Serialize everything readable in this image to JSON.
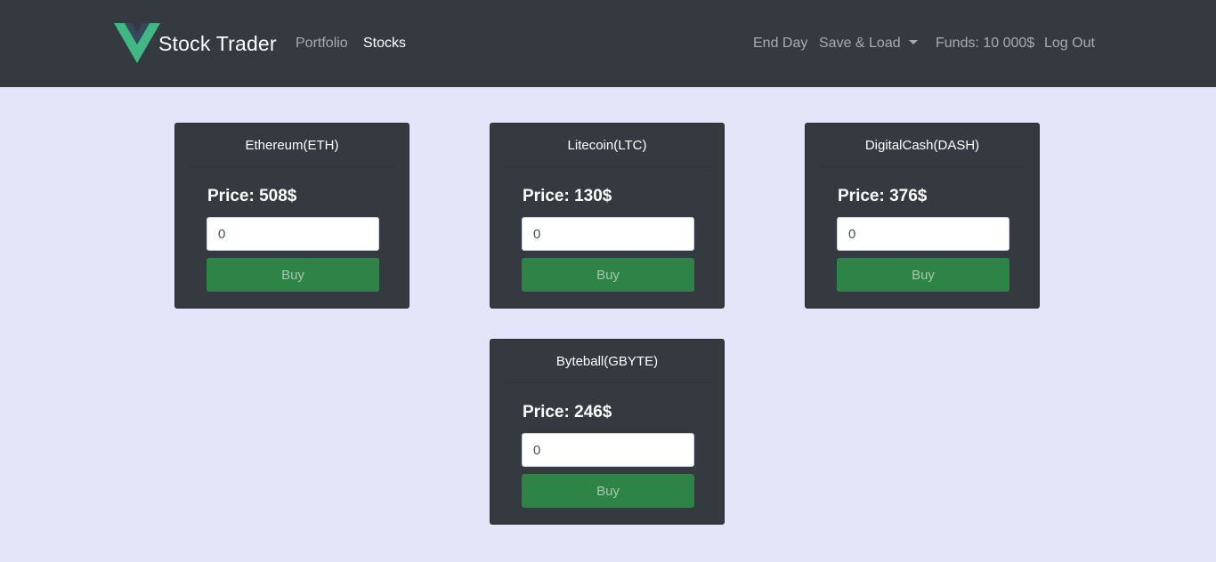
{
  "brand": {
    "name": "Stock Trader",
    "logo_icon": "vue-logo-icon"
  },
  "nav": {
    "portfolio": "Portfolio",
    "stocks": "Stocks",
    "end_day": "End Day",
    "save_load": "Save & Load",
    "funds": "Funds: 10 000$",
    "logout": "Log Out"
  },
  "stocks": [
    {
      "name": "Ethereum(ETH)",
      "price": "Price: 508$",
      "quantity": "0",
      "buy_label": "Buy"
    },
    {
      "name": "Litecoin(LTC)",
      "price": "Price: 130$",
      "quantity": "0",
      "buy_label": "Buy"
    },
    {
      "name": "DigitalCash(DASH)",
      "price": "Price: 376$",
      "quantity": "0",
      "buy_label": "Buy"
    },
    {
      "name": "Byteball(GBYTE)",
      "price": "Price: 246$",
      "quantity": "0",
      "buy_label": "Buy"
    }
  ],
  "colors": {
    "navbar": "#343a40",
    "page_background": "#e4e5f8",
    "card": "#343a40",
    "buy_button": "#2e8446",
    "logo_green": "#41b883",
    "logo_dark": "#35495e"
  }
}
